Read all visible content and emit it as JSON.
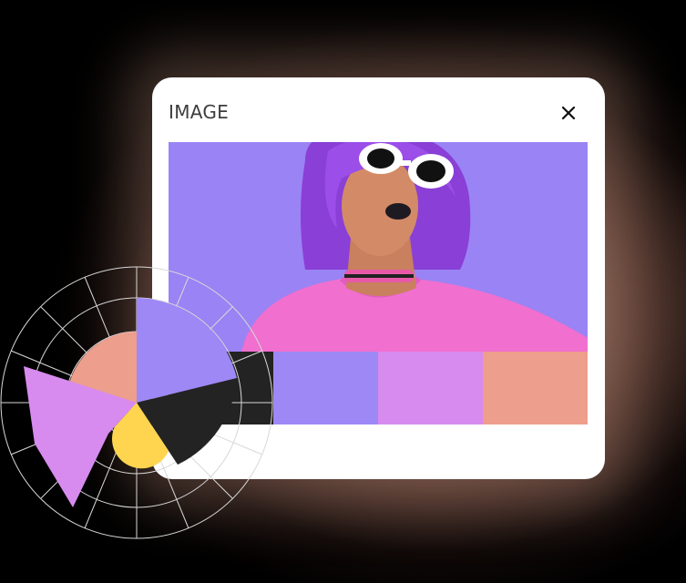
{
  "panel": {
    "title": "IMAGE",
    "close_icon": "close-icon"
  },
  "image": {
    "description_icon": "portrait-photo",
    "background_color": "#9a83f4"
  },
  "palette": {
    "swatches": [
      {
        "color": "#232323"
      },
      {
        "color": "#9e88f6"
      },
      {
        "color": "#d78bef"
      },
      {
        "color": "#ed9e8c"
      }
    ]
  },
  "color_wheel": {
    "icon": "polar-color-wheel",
    "slices": [
      {
        "color": "#9e88f6"
      },
      {
        "color": "#232323"
      },
      {
        "color": "#ffd54f"
      },
      {
        "color": "#d78bef"
      },
      {
        "color": "#ed9e8c"
      }
    ]
  }
}
